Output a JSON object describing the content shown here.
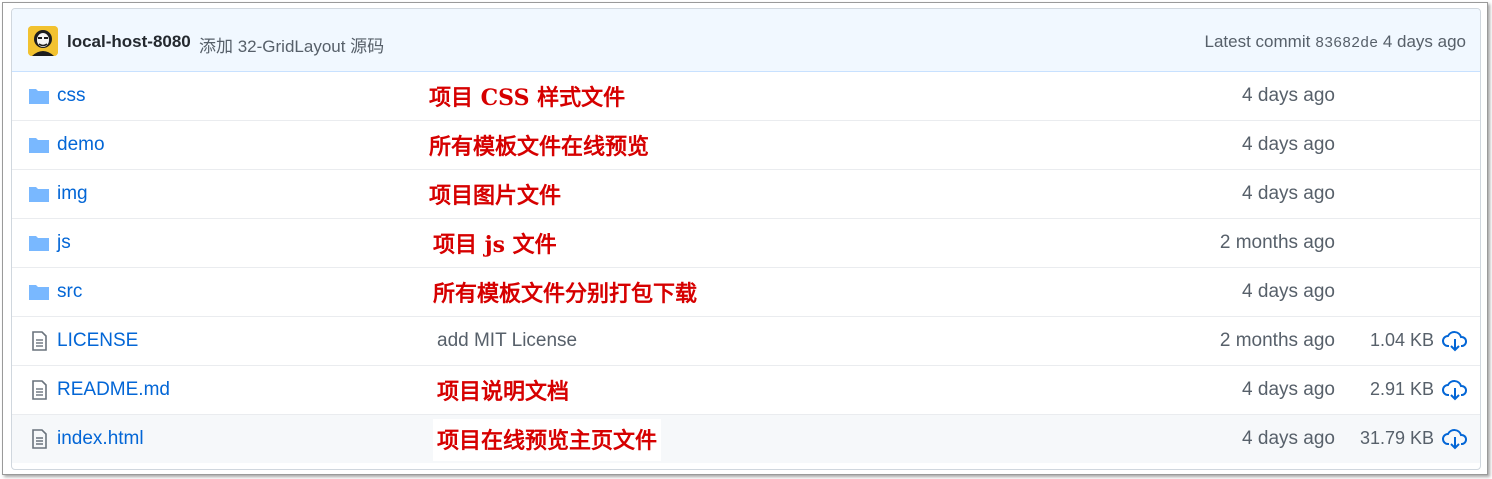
{
  "commit_bar": {
    "author": "local-host-8080",
    "message": "添加 32-GridLayout 源码",
    "latest_label": "Latest commit",
    "sha": "83682de",
    "age": "4 days ago"
  },
  "files": [
    {
      "name": "css",
      "type": "folder",
      "note": "项目 CSS 样式文件",
      "age": "4 days ago",
      "size": ""
    },
    {
      "name": "demo",
      "type": "folder",
      "note": "所有模板文件在线预览",
      "age": "4 days ago",
      "size": ""
    },
    {
      "name": "img",
      "type": "folder",
      "note": "项目图片文件",
      "age": "4 days ago",
      "size": ""
    },
    {
      "name": "js",
      "type": "folder",
      "note": "项目 js 文件",
      "age": "2 months ago",
      "size": ""
    },
    {
      "name": "src",
      "type": "folder",
      "note": "所有模板文件分别打包下载",
      "age": "4 days ago",
      "size": ""
    },
    {
      "name": "LICENSE",
      "type": "file",
      "note": "add MIT License",
      "age": "2 months ago",
      "size": "1.04 KB"
    },
    {
      "name": "README.md",
      "type": "file",
      "note": "项目说明文档",
      "age": "4 days ago",
      "size": "2.91 KB"
    },
    {
      "name": "index.html",
      "type": "file",
      "note": "项目在线预览主页文件",
      "age": "4 days ago",
      "size": "31.79 KB"
    }
  ],
  "colors": {
    "link": "#0366d6",
    "annotation": "#d60000",
    "header_bg": "#f1f8ff",
    "folder": "#79b8ff"
  }
}
